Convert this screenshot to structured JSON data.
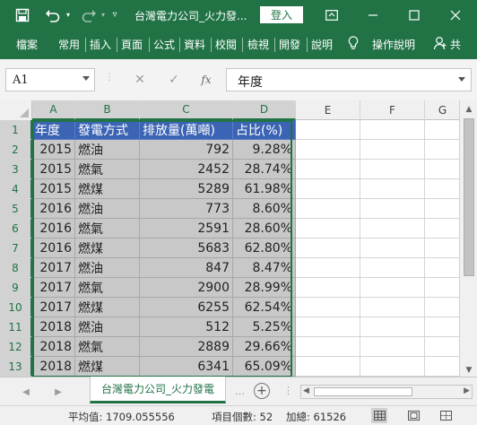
{
  "titlebar": {
    "title": "台灣電力公司_火力發...",
    "signin_label": "登入"
  },
  "ribbon": {
    "tabs": [
      "檔案",
      "常用",
      "插入",
      "頁面",
      "公式",
      "資料",
      "校閱",
      "檢視",
      "開發",
      "說明"
    ],
    "tell_me": "操作說明",
    "share": "共"
  },
  "formula_bar": {
    "name_box": "A1",
    "fx": "fx",
    "content": "年度"
  },
  "grid": {
    "columns": [
      "A",
      "B",
      "C",
      "D",
      "E",
      "F",
      "G"
    ],
    "rows": [
      "1",
      "2",
      "3",
      "4",
      "5",
      "6",
      "7",
      "8",
      "9",
      "10",
      "11",
      "12",
      "13"
    ],
    "header": [
      "年度",
      "發電方式",
      "排放量(萬噸)",
      "占比(%)"
    ],
    "data": [
      [
        "2015",
        "燃油",
        "792",
        "9.28%"
      ],
      [
        "2015",
        "燃氣",
        "2452",
        "28.74%"
      ],
      [
        "2015",
        "燃煤",
        "5289",
        "61.98%"
      ],
      [
        "2016",
        "燃油",
        "773",
        "8.60%"
      ],
      [
        "2016",
        "燃氣",
        "2591",
        "28.60%"
      ],
      [
        "2016",
        "燃煤",
        "5683",
        "62.80%"
      ],
      [
        "2017",
        "燃油",
        "847",
        "8.47%"
      ],
      [
        "2017",
        "燃氣",
        "2900",
        "28.99%"
      ],
      [
        "2017",
        "燃煤",
        "6255",
        "62.54%"
      ],
      [
        "2018",
        "燃油",
        "512",
        "5.25%"
      ],
      [
        "2018",
        "燃氣",
        "2889",
        "29.66%"
      ],
      [
        "2018",
        "燃煤",
        "6341",
        "65.09%"
      ]
    ]
  },
  "sheet_tabs": {
    "active": "台灣電力公司_火力發電"
  },
  "status": {
    "average": "平均值: 1709.055556",
    "count": "項目個數: 52",
    "sum": "加總: 61526"
  },
  "colors": {
    "accent": "#217346",
    "header_fill": "#3c64b4",
    "selection": "#c8c8c8"
  }
}
